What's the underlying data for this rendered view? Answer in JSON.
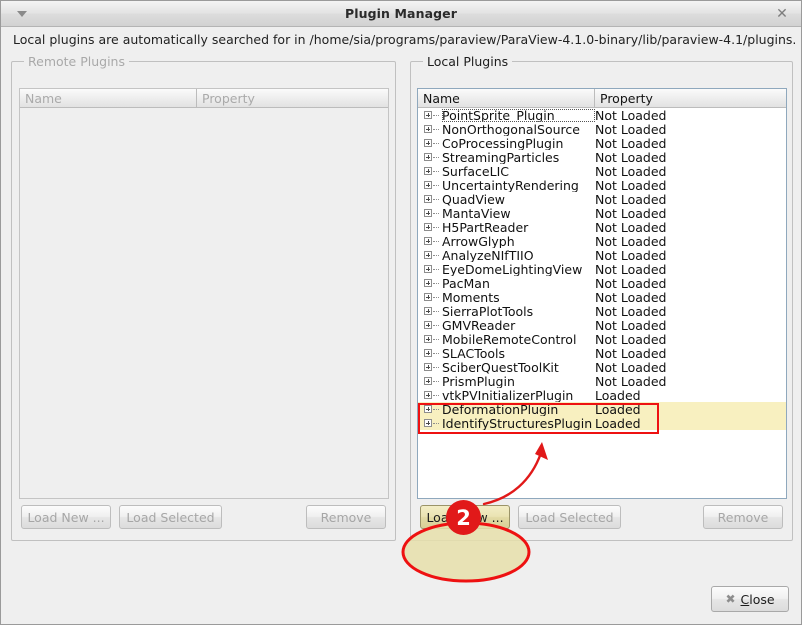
{
  "window": {
    "title": "Plugin Manager",
    "menu_icon": "chevron-down-icon",
    "close_icon": "close-icon",
    "description": "Local plugins are automatically searched for in /home/sia/programs/paraview/ParaView-4.1.0-binary/lib/paraview-4.1/plugins."
  },
  "remote_panel": {
    "title": "Remote Plugins",
    "columns": {
      "name": "Name",
      "property": "Property"
    },
    "rows": [],
    "buttons": {
      "load_new": "Load New ...",
      "load_selected": "Load Selected",
      "remove": "Remove"
    }
  },
  "local_panel": {
    "title": "Local Plugins",
    "columns": {
      "name": "Name",
      "property": "Property"
    },
    "rows": [
      {
        "name": "PointSprite_Plugin",
        "property": "Not Loaded"
      },
      {
        "name": "NonOrthogonalSource",
        "property": "Not Loaded"
      },
      {
        "name": "CoProcessingPlugin",
        "property": "Not Loaded"
      },
      {
        "name": "StreamingParticles",
        "property": "Not Loaded"
      },
      {
        "name": "SurfaceLIC",
        "property": "Not Loaded"
      },
      {
        "name": "UncertaintyRendering",
        "property": "Not Loaded"
      },
      {
        "name": "QuadView",
        "property": "Not Loaded"
      },
      {
        "name": "MantaView",
        "property": "Not Loaded"
      },
      {
        "name": "H5PartReader",
        "property": "Not Loaded"
      },
      {
        "name": "ArrowGlyph",
        "property": "Not Loaded"
      },
      {
        "name": "AnalyzeNIfTIIO",
        "property": "Not Loaded"
      },
      {
        "name": "EyeDomeLightingView",
        "property": "Not Loaded"
      },
      {
        "name": "PacMan",
        "property": "Not Loaded"
      },
      {
        "name": "Moments",
        "property": "Not Loaded"
      },
      {
        "name": "SierraPlotTools",
        "property": "Not Loaded"
      },
      {
        "name": "GMVReader",
        "property": "Not Loaded"
      },
      {
        "name": "MobileRemoteControl",
        "property": "Not Loaded"
      },
      {
        "name": "SLACTools",
        "property": "Not Loaded"
      },
      {
        "name": "SciberQuestToolKit",
        "property": "Not Loaded"
      },
      {
        "name": "PrismPlugin",
        "property": "Not Loaded"
      },
      {
        "name": "vtkPVInitializerPlugin",
        "property": "Loaded"
      },
      {
        "name": "DeformationPlugin",
        "property": "Loaded",
        "highlighted": true
      },
      {
        "name": "IdentifyStructuresPlugin",
        "property": "Loaded",
        "highlighted": true
      }
    ],
    "buttons": {
      "load_new": "Load New ...",
      "load_selected": "Load Selected",
      "remove": "Remove"
    }
  },
  "dialog_buttons": {
    "close": "Close",
    "close_icon": "close-x-icon",
    "close_mnemonic": "C"
  },
  "annotations": {
    "step_badge": "2",
    "highlight_color": "#ee1111",
    "badge_color": "#e11919",
    "row_highlight_color": "#f8f0c0",
    "button_highlight_color": "#e6dfaa"
  }
}
